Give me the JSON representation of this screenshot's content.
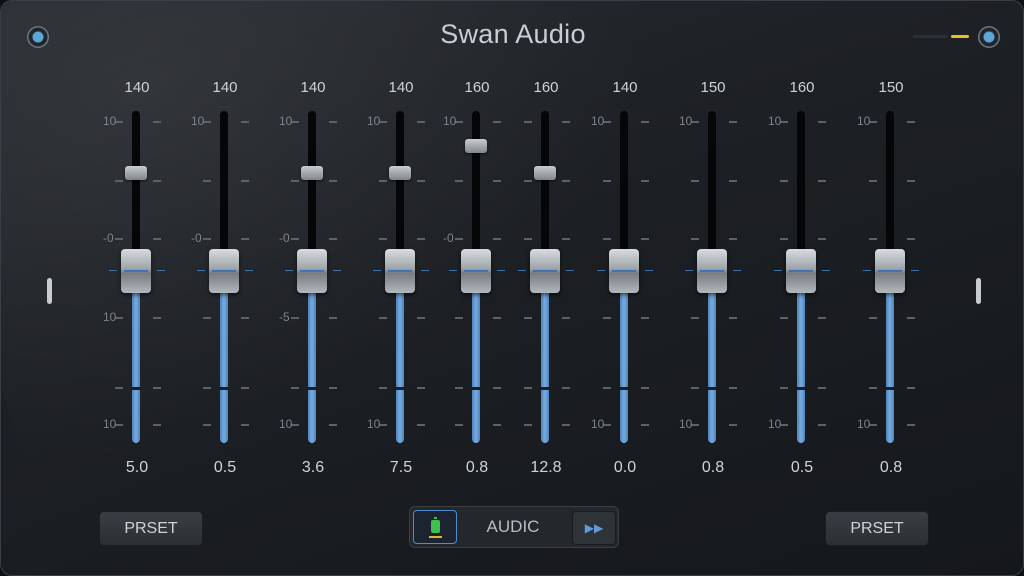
{
  "app": {
    "title": "Swan Audio"
  },
  "colors": {
    "accent_blue": "#6ea2d8",
    "indicator_yellow": "#e8c21f",
    "panel": "#1e2226"
  },
  "icons": {
    "top_left": "settings-knob-icon",
    "top_right": "settings-knob-icon",
    "transport_left": "battery-icon",
    "transport_right": "skip-forward-icon"
  },
  "bands": [
    {
      "freq": "140",
      "value": "5.0",
      "scale": [
        "10",
        "",
        "-0",
        "10",
        "",
        "10"
      ]
    },
    {
      "freq": "140",
      "value": "0.5",
      "scale": [
        "10",
        "",
        "-0",
        "",
        "",
        ""
      ]
    },
    {
      "freq": "140",
      "value": "3.6",
      "scale": [
        "10",
        "",
        "-0",
        "-5",
        "",
        "10"
      ]
    },
    {
      "freq": "140",
      "value": "7.5",
      "scale": [
        "10",
        "",
        "",
        "",
        "",
        "10"
      ]
    },
    {
      "freq": "160",
      "value": "0.8",
      "scale": [
        "10",
        "",
        "-0",
        "",
        "",
        ""
      ]
    },
    {
      "freq": "160",
      "value": "12.8",
      "scale": [
        "",
        "",
        "",
        "",
        "",
        ""
      ]
    },
    {
      "freq": "140",
      "value": "0.0",
      "scale": [
        "10",
        "",
        "",
        "",
        "",
        "10"
      ]
    },
    {
      "freq": "150",
      "value": "0.8",
      "scale": [
        "10",
        "",
        "",
        "",
        "",
        "10"
      ]
    },
    {
      "freq": "160",
      "value": "0.5",
      "scale": [
        "10",
        "",
        "",
        "",
        "",
        "10"
      ]
    },
    {
      "freq": "150",
      "value": "0.8",
      "scale": [
        "10",
        "",
        "",
        "",
        "",
        "10"
      ]
    }
  ],
  "footer": {
    "left_button": "PRSET",
    "center_label": "AUDIC",
    "right_button": "PRSET",
    "skip_glyph": "▶▶"
  }
}
